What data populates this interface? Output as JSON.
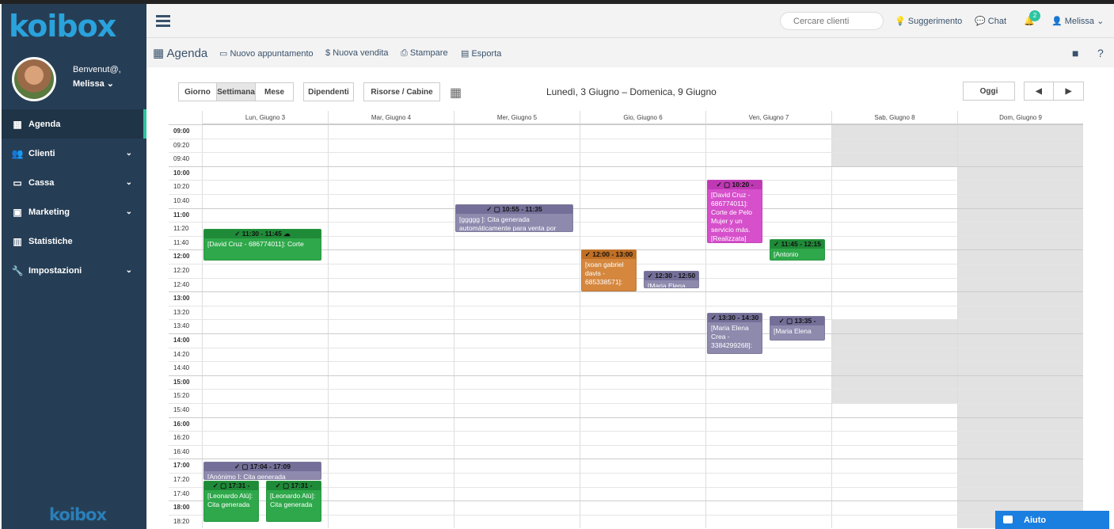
{
  "app": {
    "logo": "koibox",
    "bottom_logo": "koibox"
  },
  "sidebar": {
    "welcome": "Benvenut@,",
    "user": "Melissa ⌄",
    "items": [
      {
        "label": "Agenda",
        "icon": "calendar-icon",
        "chev": ""
      },
      {
        "label": "Clienti",
        "icon": "users-icon",
        "chev": "⌄"
      },
      {
        "label": "Cassa",
        "icon": "drawer-icon",
        "chev": "⌄"
      },
      {
        "label": "Marketing",
        "icon": "briefcase-icon",
        "chev": "⌄"
      },
      {
        "label": "Statistiche",
        "icon": "bar-chart-icon",
        "chev": ""
      },
      {
        "label": "Impostazioni",
        "icon": "wrench-icon",
        "chev": "⌄"
      }
    ]
  },
  "topbar": {
    "search_placeholder": "Cercare clienti",
    "suggest": "Suggerimento",
    "chat": "Chat",
    "notifications": "2",
    "user": "Melissa ⌄"
  },
  "toolbar": {
    "agenda": "Agenda",
    "new_appointment": "Nuovo appuntamento",
    "new_sale": "Nuova vendita",
    "print": "Stampare",
    "export": "Esporta"
  },
  "calendar": {
    "views": [
      "Giorno",
      "Settimana",
      "Mese"
    ],
    "dipendenti": "Dipendenti",
    "risorse": "Risorse / Cabine",
    "title": "Lunedì, 3 Giugno – Domenica, 9 Giugno",
    "today": "Oggi",
    "prev": "◀",
    "next": "▶",
    "days": [
      "Lun, Giugno 3",
      "Mar, Giugno 4",
      "Mer, Giugno 5",
      "Gio, Giugno 6",
      "Ven, Giugno 7",
      "Sab, Giugno 8",
      "Dom, Giugno 9"
    ],
    "times": [
      "09:00",
      "09:20",
      "09:40",
      "10:00",
      "10:20",
      "10:40",
      "11:00",
      "11:20",
      "11:40",
      "12:00",
      "12:20",
      "12:40",
      "13:00",
      "13:20",
      "13:40",
      "14:00",
      "14:20",
      "14:40",
      "15:00",
      "15:20",
      "15:40",
      "16:00",
      "16:20",
      "16:40",
      "17:00",
      "17:20",
      "17:40",
      "18:00",
      "18:20"
    ],
    "events": [
      {
        "day": 0,
        "time": "✓ 11:30 - 11:45 ☁",
        "text": "[David Cruz - 686774011]: Corte",
        "color": "green",
        "start": 150,
        "end": 195
      },
      {
        "day": 2,
        "time": "✓ ▢ 10:55 - 11:35",
        "text": "[ggggg ]: Cita generada automáticamente para venta por",
        "color": "purple",
        "start": 115,
        "end": 155
      },
      {
        "day": 3,
        "time": "✓ 12:00 - 13:00",
        "text": "[xoan gabriel davis - 685338571]:",
        "color": "orange",
        "start": 180,
        "end": 240
      },
      {
        "day": 3,
        "time": "✓ 12:30 - 12:50",
        "text": "[Maria Elena",
        "color": "purple",
        "start": 210,
        "end": 230
      },
      {
        "day": 4,
        "time": "✓ ▢ 10:20 -",
        "text": "[David Cruz - 686774011]: Corte de Pelo Mujer y un servicio más. [Realizzata]",
        "color": "magenta",
        "start": 80,
        "end": 170
      },
      {
        "day": 4,
        "time": "✓ 11:45 - 12:15",
        "text": "[Antonio",
        "color": "green",
        "start": 165,
        "end": 195
      },
      {
        "day": 4,
        "time": "✓ 13:30 - 14:30",
        "text": "[Maria Elena Crea - 3384299268]:",
        "color": "purple",
        "start": 270,
        "end": 330
      },
      {
        "day": 4,
        "time": "✓ ▢ 13:35 -",
        "text": "[Maria Elena",
        "color": "purple",
        "start": 275,
        "end": 310
      },
      {
        "day": 0,
        "time": "✓ ▢ 17:04 - 17:09",
        "text": "[Anónimo ]: Cita generada",
        "color": "purple",
        "start": 484,
        "end": 510
      },
      {
        "day": 0,
        "time": "✓ ▢ 17:31 -",
        "text": "[Leonardo Alù]: Cita generada",
        "color": "green",
        "start": 511,
        "end": 570
      },
      {
        "day": 0,
        "time": "✓ ▢ 17:31 -",
        "text": "[Leonardo Alù]: Cita generada",
        "color": "green",
        "start": 511,
        "end": 570
      }
    ]
  },
  "help": {
    "label": "Aiuto"
  }
}
